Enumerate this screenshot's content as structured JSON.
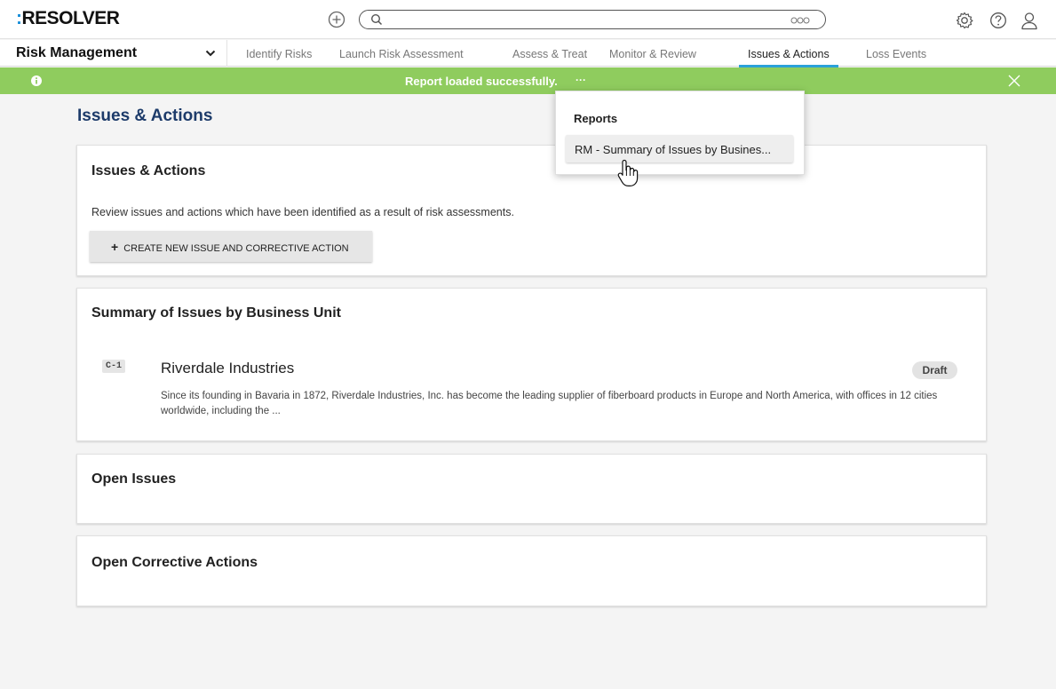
{
  "logo": {
    "colon": ":",
    "text": "RESOLVER"
  },
  "topbar": {
    "add_icon": "plus-circle-icon",
    "search_placeholder": "",
    "search_icon": "search-icon",
    "more_icon": "ellipsis-icon",
    "icons": [
      "gear-icon",
      "help-icon",
      "user-icon"
    ]
  },
  "app": {
    "name": "Risk Management",
    "chevron_icon": "chevron-down-icon"
  },
  "nav": {
    "tabs": [
      {
        "label": "Identify Risks"
      },
      {
        "label": "Launch Risk Assessment"
      },
      {
        "label": "Assess & Treat"
      },
      {
        "label": "Monitor & Review"
      },
      {
        "label": "Issues & Actions",
        "active": true
      },
      {
        "label": "Loss Events"
      }
    ]
  },
  "banner": {
    "message": "Report loaded successfully.",
    "ellipsis": "···",
    "color": "#8fcc5e",
    "info_icon": "info-icon",
    "close_icon": "close-icon"
  },
  "page": {
    "title": "Issues & Actions"
  },
  "issues_card": {
    "title": "Issues & Actions",
    "description": "Review issues and actions which have been identified as a result of risk assessments.",
    "create_button": {
      "plus": "+",
      "label": "CREATE NEW ISSUE AND CORRECTIVE ACTION"
    }
  },
  "summary_card": {
    "title": "Summary of Issues by Business Unit",
    "item": {
      "id": "C-1",
      "name": "Riverdale Industries",
      "status": "Draft",
      "description": "Since its founding in Bavaria in 1872, Riverdale Industries, Inc. has become the leading supplier of fiberboard products in Europe and North America, with offices in 12 cities worldwide, including the ..."
    }
  },
  "open_issues_card": {
    "title": "Open Issues"
  },
  "open_actions_card": {
    "title": "Open Corrective Actions"
  },
  "reports_dropdown": {
    "heading": "Reports",
    "items": [
      {
        "label": "RM - Summary of Issues by Busines..."
      }
    ]
  },
  "colors": {
    "accent": "#2aa1d9",
    "title": "#1d3b6a",
    "success": "#8fcc5e"
  }
}
